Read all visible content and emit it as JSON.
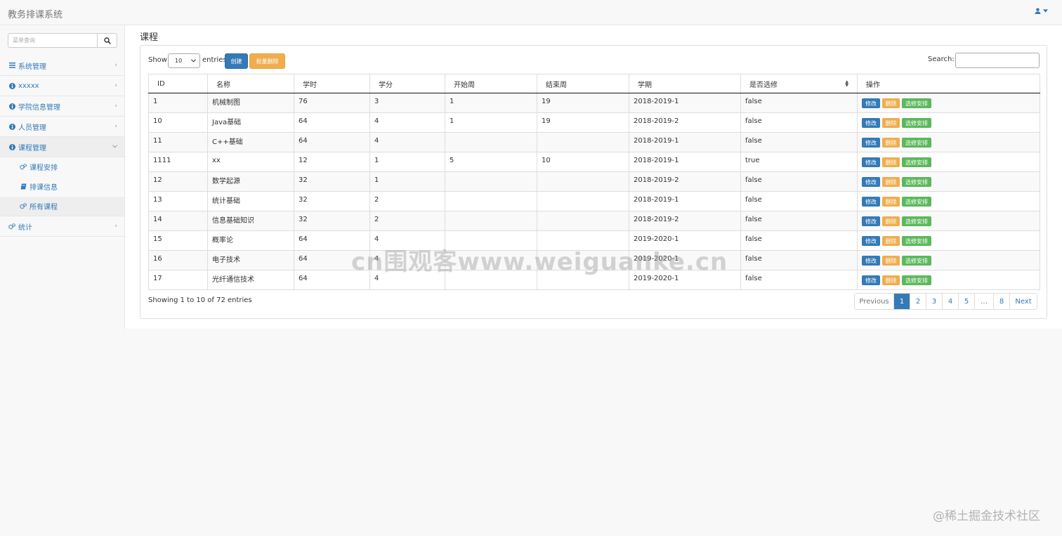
{
  "app": {
    "title": "教务排课系统"
  },
  "sidebar": {
    "search_placeholder": "菜单查询",
    "items": [
      {
        "label": "系统管理",
        "icon": "bars-icon"
      },
      {
        "label": "xxxxx",
        "icon": "info-circle-icon"
      },
      {
        "label": "学院信息管理",
        "icon": "info-circle-icon"
      },
      {
        "label": "人员管理",
        "icon": "info-circle-icon"
      },
      {
        "label": "课程管理",
        "icon": "info-circle-icon",
        "expanded": true
      }
    ],
    "subitems": [
      {
        "label": "课程安排",
        "icon": "gears-icon"
      },
      {
        "label": "排课信息",
        "icon": "book-icon"
      },
      {
        "label": "所有课程",
        "icon": "gears-icon",
        "active": true
      }
    ],
    "last_item": {
      "label": "统计",
      "icon": "gears-icon"
    }
  },
  "main": {
    "title": "课程",
    "length": {
      "show": "Show",
      "value": "10",
      "entries": "entries"
    },
    "buttons": {
      "create": "创建",
      "batch_delete": "批量删除"
    },
    "search_label": "Search:",
    "table": {
      "columns": [
        "ID",
        "名称",
        "学时",
        "学分",
        "开始周",
        "结束周",
        "学期",
        "是否选修",
        "操作"
      ],
      "rows": [
        [
          "1",
          "机械制图",
          "76",
          "3",
          "1",
          "19",
          "2018-2019-1",
          "false"
        ],
        [
          "10",
          "Java基础",
          "64",
          "4",
          "1",
          "19",
          "2018-2019-2",
          "false"
        ],
        [
          "11",
          "C++基础",
          "64",
          "4",
          "",
          "",
          "2018-2019-1",
          "false"
        ],
        [
          "1111",
          "xx",
          "12",
          "1",
          "5",
          "10",
          "2018-2019-1",
          "true"
        ],
        [
          "12",
          "数学起源",
          "32",
          "1",
          "",
          "",
          "2018-2019-2",
          "false"
        ],
        [
          "13",
          "统计基础",
          "32",
          "2",
          "",
          "",
          "2018-2019-1",
          "false"
        ],
        [
          "14",
          "信息基础知识",
          "32",
          "2",
          "",
          "",
          "2018-2019-2",
          "false"
        ],
        [
          "15",
          "概率论",
          "64",
          "4",
          "",
          "",
          "2019-2020-1",
          "false"
        ],
        [
          "16",
          "电子技术",
          "64",
          "4",
          "",
          "",
          "2019-2020-1",
          "false"
        ],
        [
          "17",
          "光纤通信技术",
          "64",
          "4",
          "",
          "",
          "2019-2020-1",
          "false"
        ]
      ],
      "row_actions": {
        "edit": "修改",
        "delete": "删除",
        "elective": "选修安排"
      }
    },
    "info": "Showing 1 to 10 of 72 entries",
    "pagination": [
      "Previous",
      "1",
      "2",
      "3",
      "4",
      "5",
      "…",
      "8",
      "Next"
    ],
    "current_page": "1"
  },
  "watermark": "cn围观客www.weiguanke.cn",
  "corner_watermark": "@稀土掘金技术社区",
  "colors": {
    "primary": "#337ab7",
    "warning": "#f0ad4e",
    "success": "#5cb85c"
  }
}
